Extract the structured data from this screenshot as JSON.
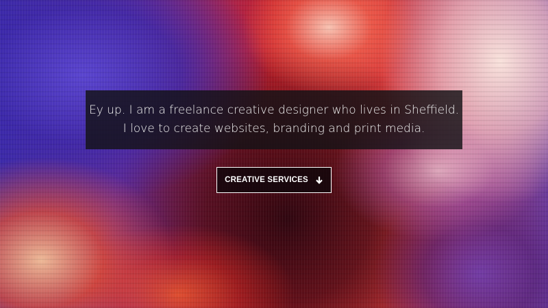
{
  "hero": {
    "tagline_lines": [
      "Ey up. I am a freelance creative designer who lives in Sheffield.",
      "I love to create websites, branding and print media."
    ],
    "cta": {
      "label": "CREATIVE SERVICES",
      "icon": "arrow-down-icon"
    }
  },
  "colors": {
    "text": "#f2f2f2",
    "button_border": "#ffffff",
    "tagline_background": "#141216"
  }
}
